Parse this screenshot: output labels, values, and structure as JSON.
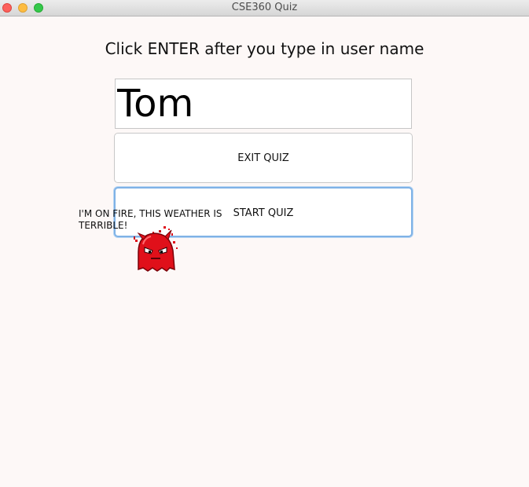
{
  "window": {
    "title": "CSE360 Quiz"
  },
  "prompt": "Click ENTER after you type in user name",
  "username_field": {
    "value": "Tom"
  },
  "buttons": {
    "exit_label": "EXIT QUIZ",
    "start_label": "START QUIZ"
  },
  "speech": {
    "text": "I'M ON FIRE, THIS WEATHER IS TERRIBLE!"
  },
  "colors": {
    "background": "#fdf8f7",
    "focus_ring": "#7fb2e6",
    "monster": "#e0101a"
  }
}
